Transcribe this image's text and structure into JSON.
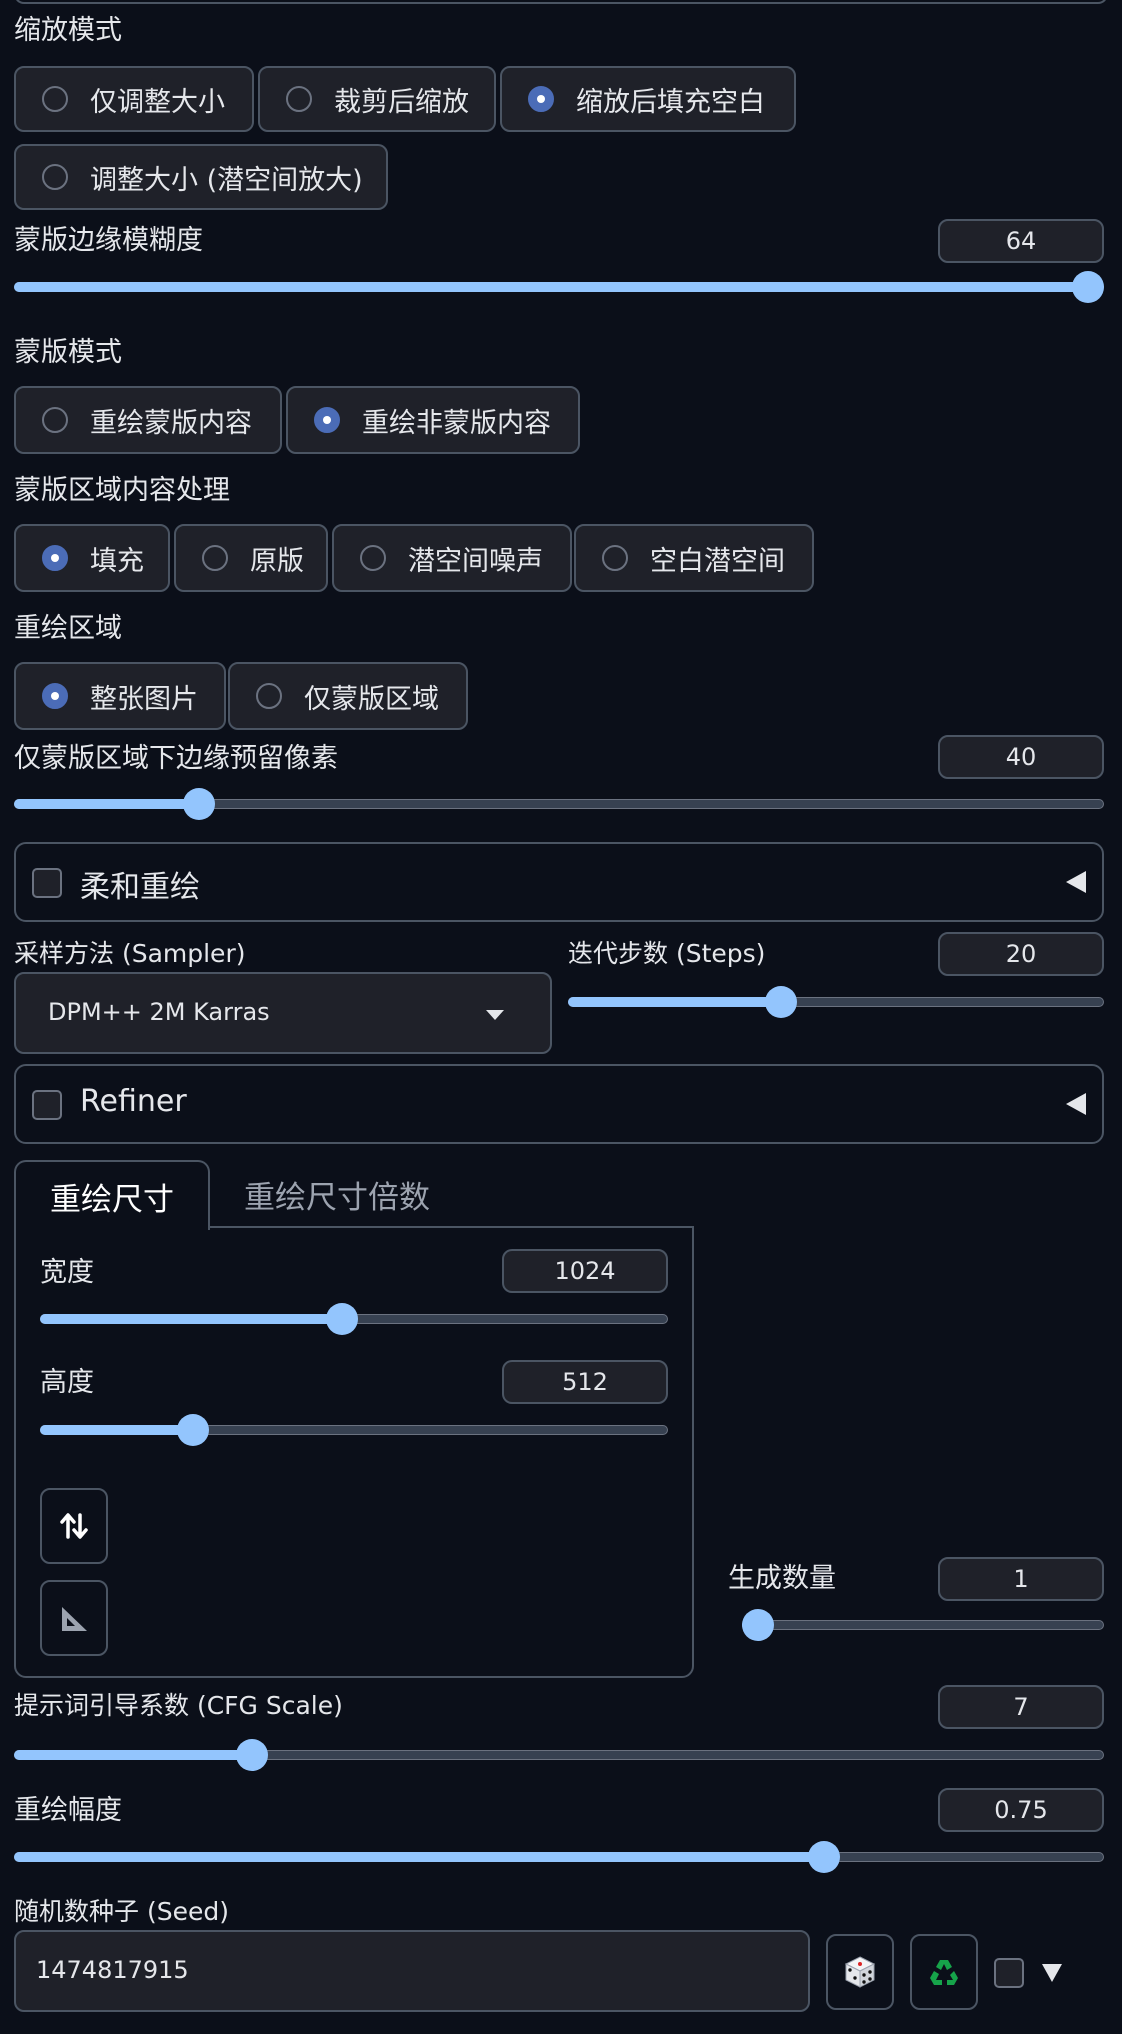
{
  "resize_mode": {
    "label": "缩放模式",
    "options": [
      "仅调整大小",
      "裁剪后缩放",
      "缩放后填充空白",
      "调整大小 (潜空间放大)"
    ],
    "selected": "缩放后填充空白"
  },
  "mask_blur": {
    "label": "蒙版边缘模糊度",
    "value": "64",
    "fraction": 1.0
  },
  "mask_mode": {
    "label": "蒙版模式",
    "options": [
      "重绘蒙版内容",
      "重绘非蒙版内容"
    ],
    "selected": "重绘非蒙版内容"
  },
  "masked_content": {
    "label": "蒙版区域内容处理",
    "options": [
      "填充",
      "原版",
      "潜空间噪声",
      "空白潜空间"
    ],
    "selected": "填充"
  },
  "inpaint_area": {
    "label": "重绘区域",
    "options": [
      "整张图片",
      "仅蒙版区域"
    ],
    "selected": "整张图片"
  },
  "only_masked_padding": {
    "label": "仅蒙版区域下边缘预留像素",
    "value": "40",
    "fraction": 0.16
  },
  "soft_inpaint": {
    "label": "柔和重绘",
    "checked": false
  },
  "sampler": {
    "label": "采样方法 (Sampler)",
    "value": "DPM++ 2M Karras"
  },
  "steps": {
    "label": "迭代步数 (Steps)",
    "value": "20",
    "fraction": 0.39
  },
  "refiner": {
    "label": "Refiner",
    "checked": false
  },
  "size_tabs": {
    "tabs": [
      "重绘尺寸",
      "重绘尺寸倍数"
    ],
    "active": 0
  },
  "width": {
    "label": "宽度",
    "value": "1024",
    "fraction": 0.48
  },
  "height": {
    "label": "高度",
    "value": "512",
    "fraction": 0.23
  },
  "icons": {
    "swap": "swap-vertical-icon",
    "ratio": "triangle-ruler-icon",
    "random": "dice-icon",
    "reuse": "recycle-icon",
    "extra": "triangle-down-icon"
  },
  "batch_count": {
    "label": "生成数量",
    "value": "1",
    "fraction": 0.0
  },
  "cfg_scale": {
    "label": "提示词引导系数 (CFG Scale)",
    "value": "7",
    "fraction": 0.21
  },
  "denoising": {
    "label": "重绘幅度",
    "value": "0.75",
    "fraction": 0.75
  },
  "seed": {
    "label": "随机数种子 (Seed)",
    "value": "1474817915"
  },
  "colors": {
    "accent": "#93c5fd",
    "background": "#0b0f19",
    "panel": "#1f2129",
    "border": "#4b5563"
  }
}
